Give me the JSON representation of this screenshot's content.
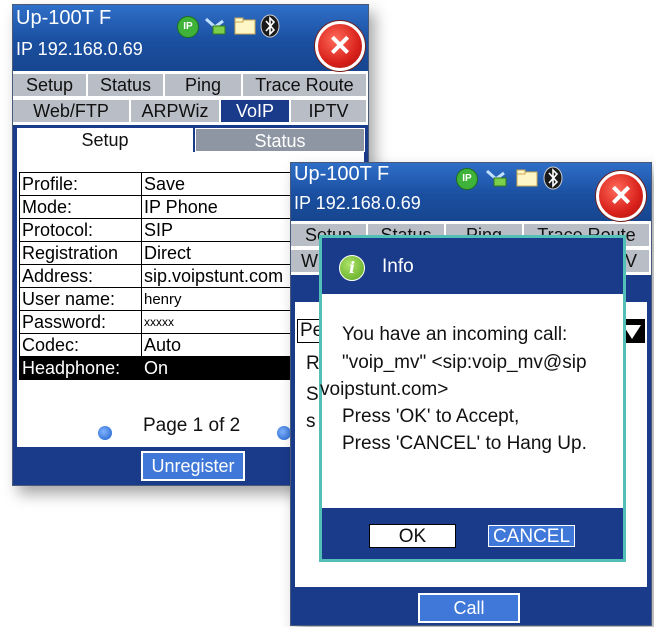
{
  "status_icons": [
    "ip-badge-icon",
    "network-plug-icon",
    "folder-icon",
    "bluetooth-icon"
  ],
  "colors": {
    "titlebar": "#1a4fa0",
    "tab_inactive": "#b9bdc5",
    "selected_tab": "#1a3a8a",
    "close": "#d8211a",
    "dialog_border": "#53c0b8"
  },
  "screen1": {
    "title": "Up-100T F",
    "ip": "IP 192.168.0.69",
    "ip_badge": "IP",
    "tabs_row1": [
      "Setup",
      "Status",
      "Ping",
      "Trace Route"
    ],
    "tabs_row2": [
      "Web/FTP",
      "ARPWiz",
      "VoIP",
      "IPTV"
    ],
    "subtabs": [
      "Setup",
      "Status"
    ],
    "form": [
      {
        "label": "Profile:",
        "value": "Save"
      },
      {
        "label": "Mode:",
        "value": "IP Phone"
      },
      {
        "label": "Protocol:",
        "value": "SIP"
      },
      {
        "label": "Registration",
        "value": "Direct"
      },
      {
        "label": "Address:",
        "value": "sip.voipstunt.com"
      },
      {
        "label": "User name:",
        "value": "henry"
      },
      {
        "label": "Password:",
        "value": "xxxxx"
      },
      {
        "label": "Codec:",
        "value": "Auto"
      },
      {
        "label": "Headphone:",
        "value": "On"
      }
    ],
    "pager": "Page 1 of 2",
    "button": "Unregister"
  },
  "screen2": {
    "title": "Up-100T F",
    "ip": "IP 192.168.0.69",
    "ip_badge": "IP",
    "tabs_row1": [
      "Setup",
      "Status",
      "Ping",
      "Trace Route"
    ],
    "tabs_row2_visible": [
      "W",
      "V"
    ],
    "form_fragment": "Pe",
    "body_fragments": [
      "R",
      "S",
      "s"
    ],
    "button": "Call"
  },
  "dialog": {
    "title": "Info",
    "lines": [
      "You have an incoming call:",
      "\"voip_mv\" <sip:voip_mv@sip",
      "voipstunt.com>",
      "Press 'OK' to Accept,",
      "Press 'CANCEL' to Hang Up."
    ],
    "ok": "OK",
    "cancel": "CANCEL"
  }
}
